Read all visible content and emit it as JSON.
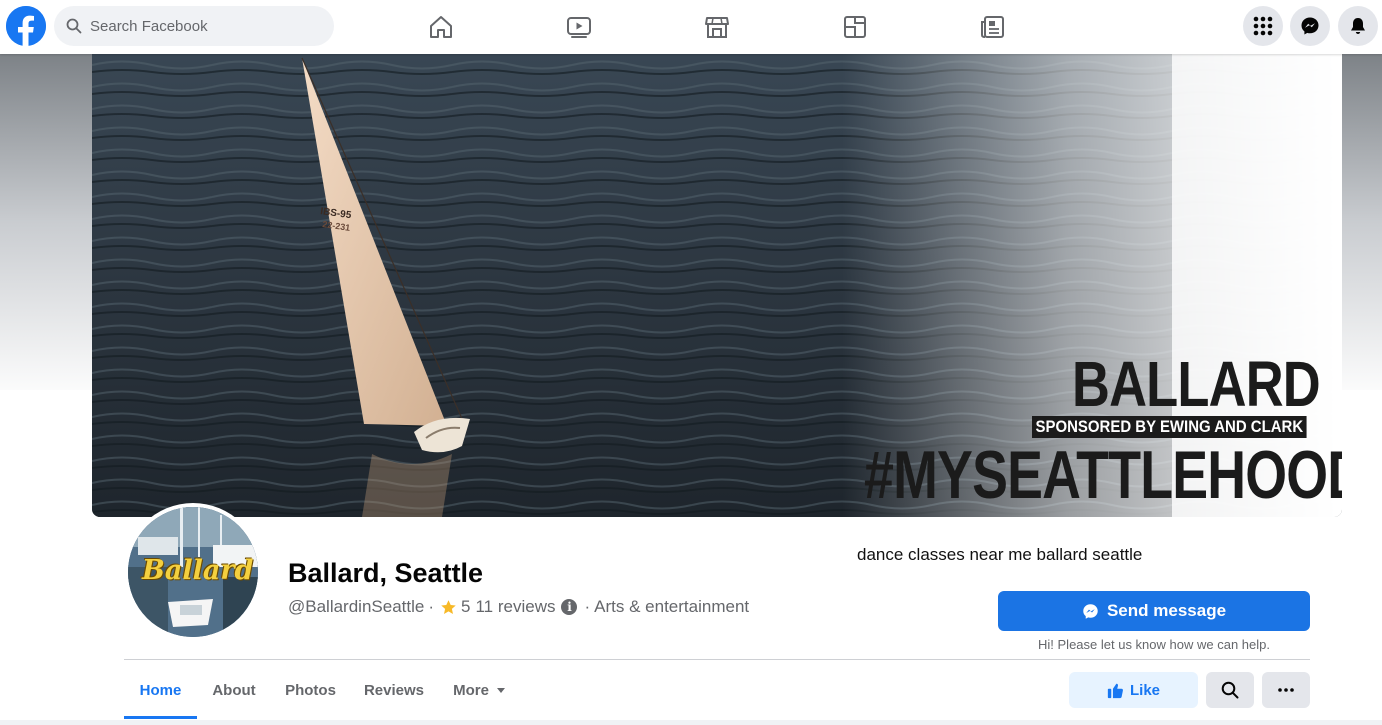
{
  "topbar": {
    "search_placeholder": "Search Facebook",
    "nav": [
      "home-icon",
      "watch-icon",
      "marketplace-icon",
      "gaming-icon",
      "news-icon"
    ],
    "actions": [
      "menu-grid-icon",
      "messenger-icon",
      "notifications-icon"
    ]
  },
  "cover": {
    "title": "BALLARD",
    "sponsor": "SPONSORED BY EWING AND CLARK",
    "hashtag": "#MYSEATTLEHOOD",
    "sail_number_1": "IBS-95",
    "sail_number_2": "22-231"
  },
  "profile": {
    "avatar_text": "Ballard",
    "name": "Ballard, Seattle",
    "handle": "@BallardinSeattle",
    "rating": "5",
    "reviews": "11 reviews",
    "category": "Arts & entertainment"
  },
  "overlay": {
    "search_phrase": "dance classes near me ballard seattle"
  },
  "actions": {
    "send_message": "Send message",
    "send_hint": "Hi! Please let us know how we can help.",
    "like": "Like"
  },
  "tabs": [
    {
      "label": "Home",
      "active": true
    },
    {
      "label": "About",
      "active": false
    },
    {
      "label": "Photos",
      "active": false
    },
    {
      "label": "Reviews",
      "active": false
    },
    {
      "label": "More",
      "active": false
    }
  ],
  "colors": {
    "brand": "#1877f2",
    "button": "#1b74e4",
    "secondary_text": "#65676b",
    "star": "#f7b928"
  }
}
